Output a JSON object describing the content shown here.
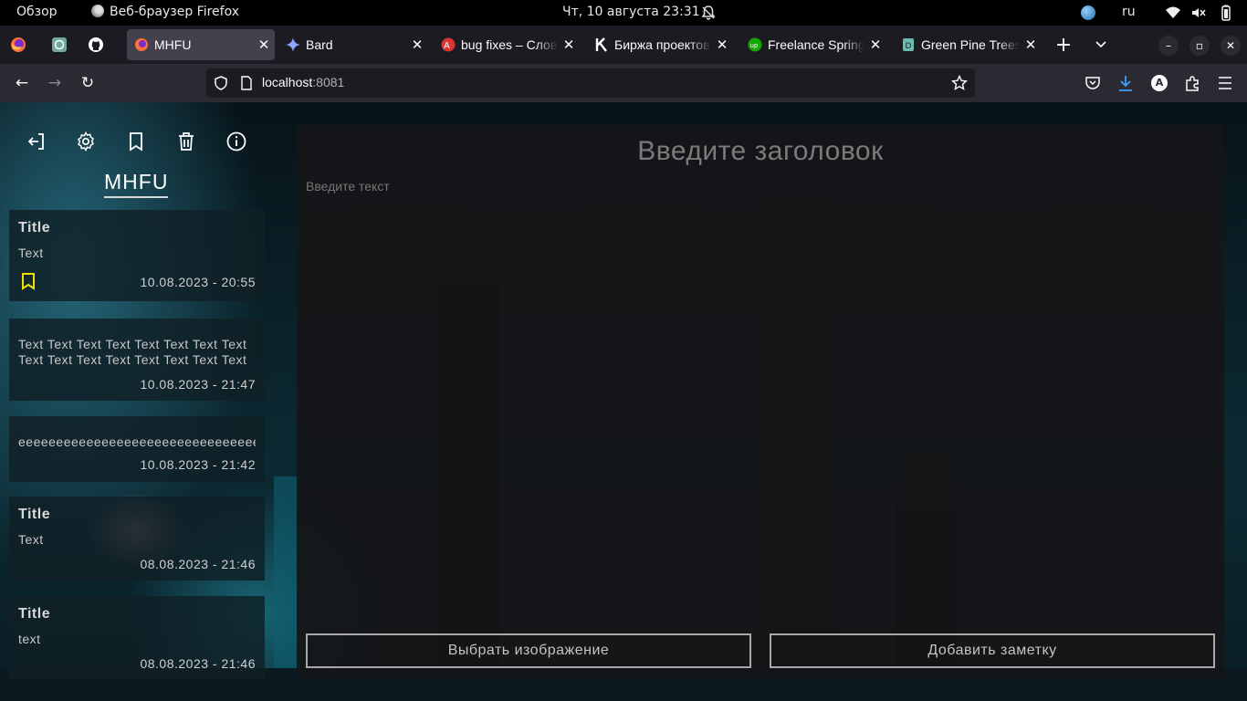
{
  "system_bar": {
    "activities": "Обзор",
    "app_name": "Веб-браузер Firefox",
    "datetime": "Чт, 10 августа  23:31",
    "language": "ru"
  },
  "tabs": [
    {
      "label": "MHFU",
      "active": true
    },
    {
      "label": "Bard",
      "active": false
    },
    {
      "label": "bug fixes – Слов",
      "active": false
    },
    {
      "label": "Биржа проектов",
      "active": false
    },
    {
      "label": "Freelance Spring",
      "active": false
    },
    {
      "label": "Green Pine Trees",
      "active": false
    }
  ],
  "address_bar": {
    "host": "localhost",
    "port": ":8081"
  },
  "profile_initial": "A",
  "sidebar": {
    "brand": "MHFU",
    "notes": [
      {
        "title": "Title",
        "text": "Text",
        "date": "10.08.2023 - 20:55",
        "bookmarked": true
      },
      {
        "title": "",
        "text": "Text Text Text Text Text Text Text Text Text Text Text Text Text Text Text Text",
        "date": "10.08.2023 - 21:47",
        "bookmarked": false
      },
      {
        "title": "",
        "text": "eeeeeeeeeeeeeeeeeeeeeeeeeeeeeeeeeeeeeeeeee",
        "date": "10.08.2023 - 21:42",
        "bookmarked": false
      },
      {
        "title": "Title",
        "text": "Text",
        "date": "08.08.2023 - 21:46",
        "bookmarked": false
      },
      {
        "title": "Title",
        "text": "text",
        "date": "08.08.2023 - 21:46",
        "bookmarked": false
      }
    ]
  },
  "editor": {
    "title_placeholder": "Введите заголовок",
    "text_placeholder": "Введите текст",
    "choose_image_label": "Выбрать изображение",
    "add_note_label": "Добавить заметку"
  },
  "colors": {
    "bookmark_accent": "#f0e000",
    "tab_active_bg": "#42414d",
    "toolbar_bg": "#2b2a33"
  }
}
